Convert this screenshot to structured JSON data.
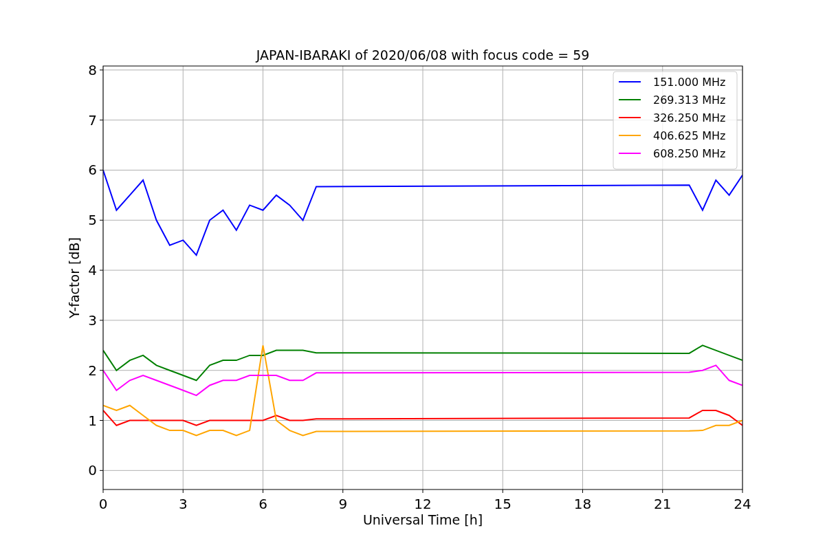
{
  "figure": {
    "chart_data": {
      "type": "line",
      "title": "JAPAN-IBARAKI of 2020/06/08 with focus code = 59",
      "xlabel": "Universal Time [h]",
      "ylabel": "Y-factor [dB]",
      "x": [
        0,
        0.5,
        1,
        1.5,
        2,
        2.5,
        3,
        3.5,
        4,
        4.5,
        5,
        5.5,
        6,
        6.5,
        7,
        7.5,
        8,
        22,
        22.5,
        23,
        23.5,
        24
      ],
      "series": [
        {
          "name": "151.000 MHz",
          "color": "#0000ff",
          "values": [
            6.0,
            5.2,
            5.5,
            5.8,
            5.0,
            4.5,
            4.6,
            4.3,
            5.0,
            5.2,
            4.8,
            5.3,
            5.2,
            5.5,
            5.3,
            5.0,
            5.67,
            5.7,
            5.2,
            5.8,
            5.5,
            5.9
          ]
        },
        {
          "name": "269.313 MHz",
          "color": "#008000",
          "values": [
            2.4,
            2.0,
            2.2,
            2.3,
            2.1,
            2.0,
            1.9,
            1.8,
            2.1,
            2.2,
            2.2,
            2.3,
            2.3,
            2.4,
            2.4,
            2.4,
            2.35,
            2.34,
            2.5,
            2.4,
            2.3,
            2.2
          ]
        },
        {
          "name": "326.250 MHz",
          "color": "#ff0000",
          "values": [
            1.2,
            0.9,
            1.0,
            1.0,
            1.0,
            1.0,
            1.0,
            0.9,
            1.0,
            1.0,
            1.0,
            1.0,
            1.0,
            1.1,
            1.0,
            1.0,
            1.03,
            1.05,
            1.2,
            1.2,
            1.1,
            0.9
          ]
        },
        {
          "name": "406.625 MHz",
          "color": "#ffa500",
          "values": [
            1.3,
            1.2,
            1.3,
            1.1,
            0.9,
            0.8,
            0.8,
            0.7,
            0.8,
            0.8,
            0.7,
            0.8,
            2.5,
            1.0,
            0.8,
            0.7,
            0.78,
            0.79,
            0.8,
            0.9,
            0.9,
            1.0
          ]
        },
        {
          "name": "608.250 MHz",
          "color": "#ff00ff",
          "values": [
            2.0,
            1.6,
            1.8,
            1.9,
            1.8,
            1.7,
            1.6,
            1.5,
            1.7,
            1.8,
            1.8,
            1.9,
            1.9,
            1.9,
            1.8,
            1.8,
            1.95,
            1.96,
            2.0,
            2.1,
            1.8,
            1.7
          ]
        }
      ],
      "xlim": [
        0,
        24
      ],
      "ylim": [
        -0.38,
        8.08
      ],
      "xticks": [
        0,
        3,
        6,
        9,
        12,
        15,
        18,
        21,
        24
      ],
      "yticks": [
        0,
        1,
        2,
        3,
        4,
        5,
        6,
        7,
        8
      ],
      "grid": true,
      "legend": true
    }
  }
}
